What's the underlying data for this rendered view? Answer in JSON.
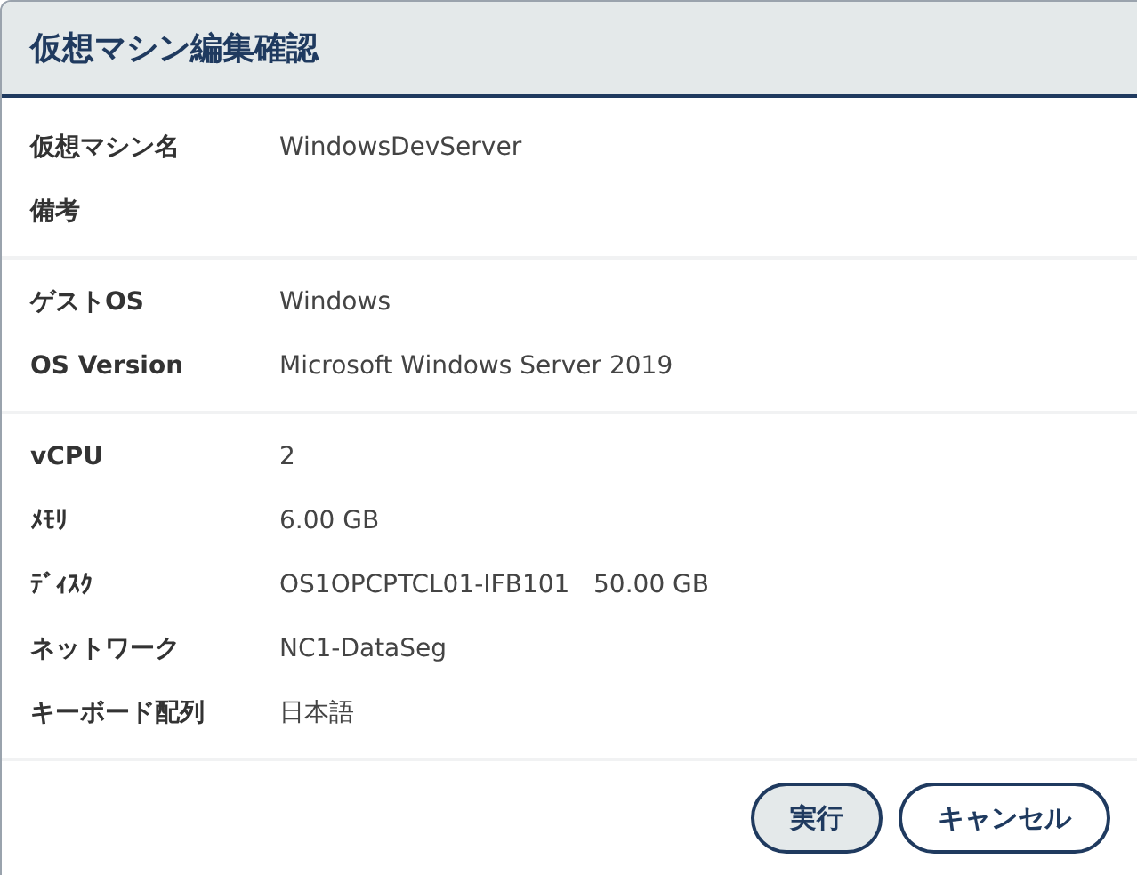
{
  "dialog": {
    "title": "仮想マシン編集確認"
  },
  "sections": [
    {
      "rows": [
        {
          "label": "仮想マシン名",
          "value": "WindowsDevServer"
        },
        {
          "label": "備考"
        }
      ]
    },
    {
      "rows": [
        {
          "label": "ゲストOS",
          "value": "Windows"
        },
        {
          "label": "OS Version",
          "value": "Microsoft Windows Server 2019"
        }
      ]
    },
    {
      "rows": [
        {
          "label": "vCPU",
          "value": "2"
        },
        {
          "label": "ﾒﾓﾘ",
          "value": "6.00 GB"
        },
        {
          "label": "ﾃﾞｨｽｸ",
          "value": "OS1OPCPTCL01-IFB101   50.00 GB"
        },
        {
          "label": "ネットワーク",
          "value": "NC1-DataSeg"
        },
        {
          "label": "キーボード配列",
          "value": "日本語"
        }
      ]
    }
  ],
  "buttons": [
    {
      "label": "実行",
      "kind": "primary"
    },
    {
      "label": "キャンセル",
      "kind": "secondary"
    }
  ]
}
